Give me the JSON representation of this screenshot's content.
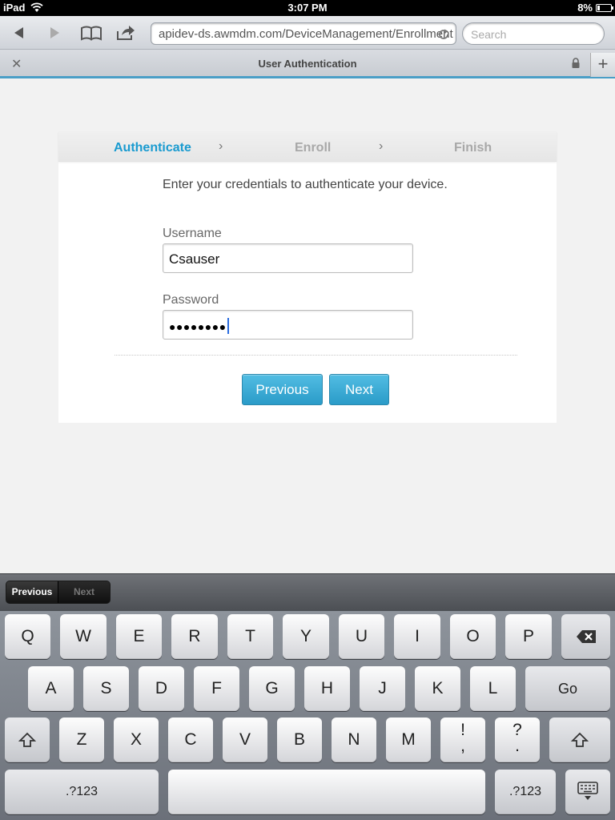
{
  "status_bar": {
    "device": "iPad",
    "time": "3:07 PM",
    "battery_pct": "8%"
  },
  "toolbar": {
    "url": "apidev-ds.awmdm.com/DeviceManagement/Enrollment",
    "search_placeholder": "Search"
  },
  "tab": {
    "title": "User Authentication"
  },
  "page": {
    "steps": [
      "Authenticate",
      "Enroll",
      "Finish"
    ],
    "active_step": "Authenticate",
    "intro": "Enter your credentials to authenticate your device.",
    "username_label": "Username",
    "username_value": "Csauser",
    "password_label": "Password",
    "password_masked": "●●●●●●●●",
    "previous_label": "Previous",
    "next_label": "Next"
  },
  "keyboard": {
    "accessory_previous": "Previous",
    "accessory_next": "Next",
    "row1": [
      "Q",
      "W",
      "E",
      "R",
      "T",
      "Y",
      "U",
      "I",
      "O",
      "P"
    ],
    "row2": [
      "A",
      "S",
      "D",
      "F",
      "G",
      "H",
      "J",
      "K",
      "L"
    ],
    "go": "Go",
    "row3": [
      "Z",
      "X",
      "C",
      "V",
      "B",
      "N",
      "M"
    ],
    "punct1": [
      "!",
      ","
    ],
    "punct2": [
      "?",
      "."
    ],
    "numbers_label": ".?123"
  },
  "colors": {
    "accent": "#1a9bd0",
    "button": "#2a9bc8",
    "tab_underline": "#4a9ec6"
  }
}
